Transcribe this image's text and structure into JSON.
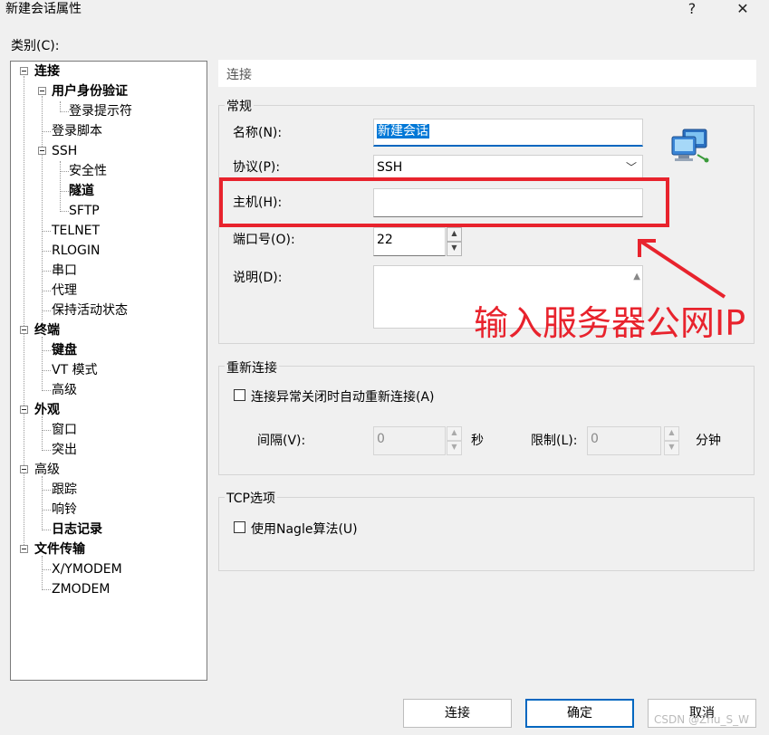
{
  "window": {
    "title": "新建会话属性",
    "help_glyph": "?",
    "close_glyph": "✕"
  },
  "category_label": "类别(C):",
  "tree": [
    {
      "label": "连接",
      "bold": true
    },
    {
      "label": "用户身份验证",
      "bold": true
    },
    {
      "label": "登录提示符",
      "bold": false
    },
    {
      "label": "登录脚本",
      "bold": false
    },
    {
      "label": "SSH",
      "bold": false
    },
    {
      "label": "安全性",
      "bold": false
    },
    {
      "label": "隧道",
      "bold": true
    },
    {
      "label": "SFTP",
      "bold": false
    },
    {
      "label": "TELNET",
      "bold": false
    },
    {
      "label": "RLOGIN",
      "bold": false
    },
    {
      "label": "串口",
      "bold": false
    },
    {
      "label": "代理",
      "bold": false
    },
    {
      "label": "保持活动状态",
      "bold": false
    },
    {
      "label": "终端",
      "bold": true
    },
    {
      "label": "键盘",
      "bold": true
    },
    {
      "label": "VT 模式",
      "bold": false
    },
    {
      "label": "高级",
      "bold": false
    },
    {
      "label": "外观",
      "bold": true
    },
    {
      "label": "窗口",
      "bold": false
    },
    {
      "label": "突出",
      "bold": false
    },
    {
      "label": "高级",
      "bold": false
    },
    {
      "label": "跟踪",
      "bold": false
    },
    {
      "label": "响铃",
      "bold": false
    },
    {
      "label": "日志记录",
      "bold": true
    },
    {
      "label": "文件传输",
      "bold": true
    },
    {
      "label": "X/YMODEM",
      "bold": false
    },
    {
      "label": "ZMODEM",
      "bold": false
    }
  ],
  "section_title": "连接",
  "general": {
    "title": "常规",
    "name_label": "名称(N):",
    "name_value": "新建会话",
    "protocol_label": "协议(P):",
    "protocol_value": "SSH",
    "host_label": "主机(H):",
    "host_value": "",
    "port_label": "端口号(O):",
    "port_value": "22",
    "desc_label": "说明(D):",
    "desc_value": ""
  },
  "reconnect": {
    "title": "重新连接",
    "checkbox_label": "连接异常关闭时自动重新连接(A)",
    "interval_label": "间隔(V):",
    "interval_value": "0",
    "seconds_unit": "秒",
    "limit_label": "限制(L):",
    "limit_value": "0",
    "minutes_unit": "分钟"
  },
  "tcp": {
    "title": "TCP选项",
    "nagle_label": "使用Nagle算法(U)"
  },
  "annotation": "输入服务器公网IP",
  "buttons": {
    "connect": "连接",
    "ok": "确定",
    "cancel": "取消"
  },
  "watermark": "CSDN @Zhu_S_W",
  "colors": {
    "annotation_red": "#e8232d",
    "selection_blue": "#0078d7"
  }
}
